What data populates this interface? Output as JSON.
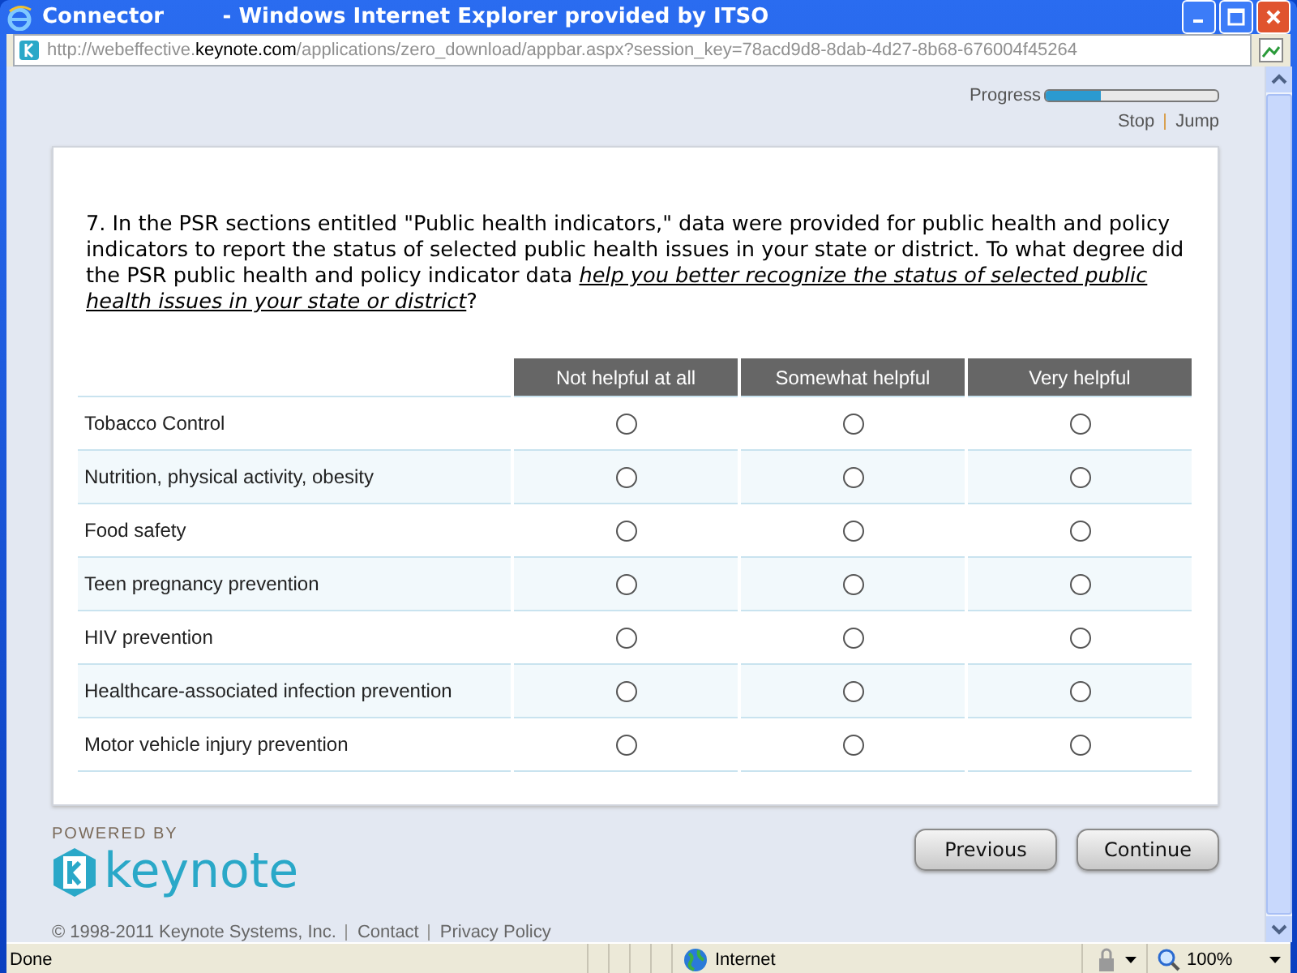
{
  "window": {
    "title": "Connector        - Windows Internet Explorer provided by ITSO"
  },
  "address": {
    "prefix": "http://webeffective.",
    "domain": "keynote.com",
    "path": "/applications/zero_download/appbar.aspx?session_key=78acd9d8-8dab-4d27-8b68-676004f45264"
  },
  "progress": {
    "label": "Progress",
    "level": 0.32
  },
  "nav_links": [
    "Stop",
    "Jump"
  ],
  "question": "7. In the PSR sections entitled \"Public health indicators,\" data were provided for public health and policy indicators to report the status of selected public health issues in your state or district. To what degree did the PSR public health and policy indicator data *help you better recognize the status of selected public health issues in your state or district*?",
  "table": {
    "columns": [
      "Not helpful at all",
      "Somewhat helpful",
      "Very helpful"
    ],
    "rows": [
      {
        "label": "Tobacco Control",
        "choices": [
          {
            "selected": false
          },
          {
            "selected": false
          },
          {
            "selected": false
          }
        ]
      },
      {
        "label": "Nutrition, physical activity, obesity",
        "choices": [
          {
            "selected": false
          },
          {
            "selected": false
          },
          {
            "selected": false
          }
        ]
      },
      {
        "label": "Food safety",
        "choices": [
          {
            "selected": false
          },
          {
            "selected": false
          },
          {
            "selected": false
          }
        ]
      },
      {
        "label": "Teen pregnancy prevention",
        "choices": [
          {
            "selected": false
          },
          {
            "selected": false
          },
          {
            "selected": false
          }
        ]
      },
      {
        "label": "HIV prevention",
        "choices": [
          {
            "selected": false
          },
          {
            "selected": false
          },
          {
            "selected": false
          }
        ]
      },
      {
        "label": "Healthcare-associated infection prevention",
        "choices": [
          {
            "selected": false
          },
          {
            "selected": false
          },
          {
            "selected": false
          }
        ]
      },
      {
        "label": "Motor vehicle injury prevention",
        "choices": [
          {
            "selected": false
          },
          {
            "selected": false
          },
          {
            "selected": false
          }
        ]
      }
    ]
  },
  "powered_by": "POWERED BY",
  "logo_text": "keynote",
  "buttons": [
    "Previous",
    "Continue"
  ],
  "footer": {
    "copyright": "© 1998-2011 Keynote Systems, Inc.",
    "links": [
      "Contact",
      "Privacy Policy"
    ]
  },
  "status_bar": {
    "text": "Done",
    "zone": "Internet",
    "zoom": "100%"
  }
}
